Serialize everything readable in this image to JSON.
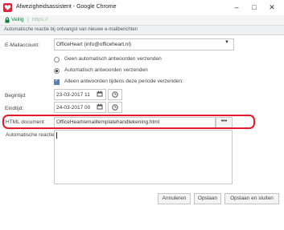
{
  "window": {
    "title": "Afwezigheidsassistent - Google Chrome",
    "minimize": "–",
    "maximize": "□",
    "close": "✕"
  },
  "addressbar": {
    "secure_label": "Veilig",
    "separator": "|",
    "url_fragment": "https://"
  },
  "subheader": {
    "text": "Automatische reactie bij ontvangst van nieuwe e-mailberichten"
  },
  "form": {
    "email_label": "E-Mailaccount:",
    "email_value": "OfficeHeart (info@officeheart.nl)",
    "radio_none_label": "Geen automatisch antwoorden verzenden",
    "radio_auto_label": "Automatisch antwoorden verzenden",
    "period_checkbox_label": "Alleen antwoorden tijdens deze periode verzenden:",
    "period_checked": true,
    "selected_radio": "auto",
    "start_label": "Begintijd:",
    "start_value": "23-03-2017 11",
    "end_label": "Eindtijd:",
    "end_value": "24-03-2017 00",
    "html_label": "HTML document",
    "html_value": "OfficeHeart/emailtemplatehandtekening.html",
    "browse_label": "•••",
    "autoreply_label": "Automatische reactie",
    "autoreply_value": ""
  },
  "buttons": {
    "cancel": "Annuleren",
    "save": "Opslaan",
    "save_close": "Opslaan en sluiten"
  },
  "colors": {
    "highlight": "#e5192b",
    "secure": "#0b8043",
    "app_icon": "#d7263d",
    "checkbox": "#5b7fb8"
  },
  "icons": {
    "app": "heart-icon",
    "lock": "lock-icon",
    "calendar": "calendar-icon",
    "clock": "clock-icon",
    "dropdown": "chevron-down-icon"
  }
}
